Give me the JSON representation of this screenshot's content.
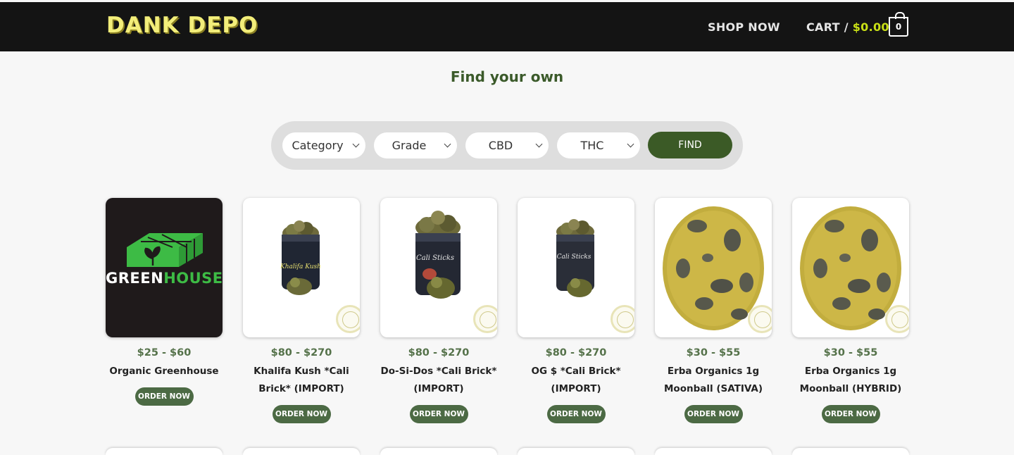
{
  "header": {
    "logo": "DANK DEPO",
    "nav_shop": "SHOP NOW",
    "nav_cart_label": "CART /",
    "nav_cart_amount": "$0.00",
    "cart_count": "0"
  },
  "main": {
    "heading": "Find your own"
  },
  "filters": {
    "category": "Category",
    "grade": "Grade",
    "cbd": "CBD",
    "thc": "THC",
    "find": "FIND"
  },
  "products": [
    {
      "price": "$25 - $60",
      "name_line1": "Organic Greenhouse",
      "name_line2": "",
      "order": "ORDER NOW",
      "logo_word1": "GREEN",
      "logo_word2": "HOUSE"
    },
    {
      "price": "$80 - $270",
      "name_line1": "Khalifa Kush *Cali",
      "name_line2": "Brick* (IMPORT)",
      "order": "ORDER NOW",
      "label": "Khalifa Kush"
    },
    {
      "price": "$80 - $270",
      "name_line1": "Do-Si-Dos *Cali Brick*",
      "name_line2": "(IMPORT)",
      "order": "ORDER NOW",
      "label": "Cali Sticks"
    },
    {
      "price": "$80 - $270",
      "name_line1": "OG $ *Cali Brick*",
      "name_line2": "(IMPORT)",
      "order": "ORDER NOW",
      "label": "Cali Sticks"
    },
    {
      "price": "$30 - $55",
      "name_line1": "Erba Organics 1g",
      "name_line2": "Moonball (SATIVA)",
      "order": "ORDER NOW"
    },
    {
      "price": "$30 - $55",
      "name_line1": "Erba Organics 1g",
      "name_line2": "Moonball (HYBRID)",
      "order": "ORDER NOW"
    }
  ],
  "colors": {
    "header_bg": "#141414",
    "logo": "#f3ee7a",
    "cart_amount": "#c9e016",
    "heading": "#3b5a2a",
    "find_button": "#3b5a26",
    "order_button": "#4c6a44",
    "price": "#55724a"
  }
}
